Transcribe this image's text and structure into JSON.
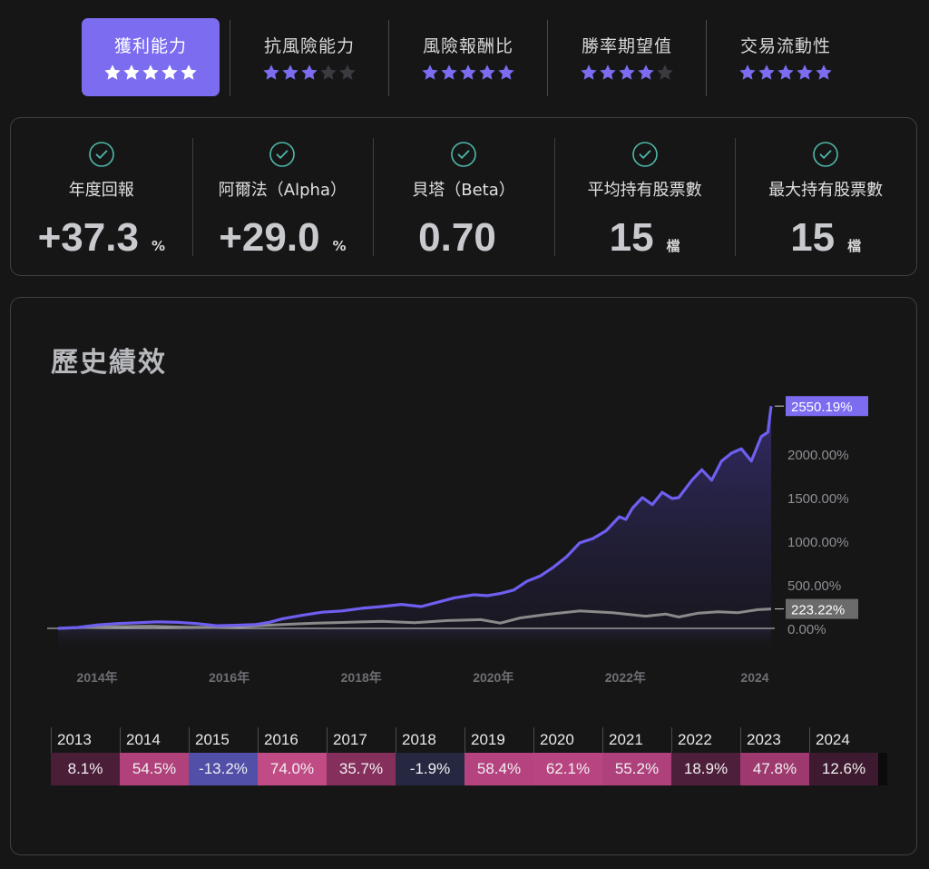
{
  "tabs": [
    {
      "label": "獲利能力",
      "stars": 5,
      "active": true
    },
    {
      "label": "抗風險能力",
      "stars": 3,
      "active": false
    },
    {
      "label": "風險報酬比",
      "stars": 5,
      "active": false
    },
    {
      "label": "勝率期望值",
      "stars": 4,
      "active": false
    },
    {
      "label": "交易流動性",
      "stars": 5,
      "active": false
    }
  ],
  "metrics": [
    {
      "label": "年度回報",
      "value": "+37.3",
      "unit": "%"
    },
    {
      "label": "阿爾法（Alpha）",
      "value": "+29.0",
      "unit": "%"
    },
    {
      "label": "貝塔（Beta）",
      "value": "0.70",
      "unit": ""
    },
    {
      "label": "平均持有股票數",
      "value": "15",
      "unit": "檔"
    },
    {
      "label": "最大持有股票數",
      "value": "15",
      "unit": "檔"
    }
  ],
  "performance": {
    "title": "歷史績效"
  },
  "colors": {
    "accent": "#7b6cf0",
    "star_on": "#7b6cf0",
    "star_off": "#3a3a3f",
    "check": "#4fb8a8",
    "strategy_line": "#6e5ff0",
    "benchmark_line": "#8a8a8a",
    "benchmark_badge": "#6b6b6b"
  },
  "chart_data": {
    "type": "line",
    "x_ticks": [
      "2014年",
      "2016年",
      "2018年",
      "2020年",
      "2022年",
      "2024"
    ],
    "y_ticks": [
      "2000.00%",
      "1500.00%",
      "1000.00%",
      "500.00%",
      "0.00%"
    ],
    "ylim": [
      0,
      2550
    ],
    "series": [
      {
        "end_label": "2550.19%",
        "points": [
          [
            2013.6,
            0
          ],
          [
            2013.9,
            10
          ],
          [
            2014.2,
            40
          ],
          [
            2014.5,
            55
          ],
          [
            2014.8,
            65
          ],
          [
            2015.1,
            75
          ],
          [
            2015.4,
            70
          ],
          [
            2015.7,
            55
          ],
          [
            2016.0,
            30
          ],
          [
            2016.3,
            35
          ],
          [
            2016.6,
            45
          ],
          [
            2016.8,
            70
          ],
          [
            2017.0,
            110
          ],
          [
            2017.3,
            150
          ],
          [
            2017.6,
            185
          ],
          [
            2017.9,
            200
          ],
          [
            2018.2,
            230
          ],
          [
            2018.5,
            250
          ],
          [
            2018.8,
            275
          ],
          [
            2019.1,
            250
          ],
          [
            2019.3,
            290
          ],
          [
            2019.6,
            350
          ],
          [
            2019.9,
            385
          ],
          [
            2020.1,
            375
          ],
          [
            2020.3,
            400
          ],
          [
            2020.5,
            440
          ],
          [
            2020.7,
            540
          ],
          [
            2020.9,
            600
          ],
          [
            2021.1,
            700
          ],
          [
            2021.3,
            820
          ],
          [
            2021.5,
            980
          ],
          [
            2021.7,
            1030
          ],
          [
            2021.9,
            1120
          ],
          [
            2022.1,
            1280
          ],
          [
            2022.2,
            1250
          ],
          [
            2022.3,
            1380
          ],
          [
            2022.45,
            1500
          ],
          [
            2022.6,
            1420
          ],
          [
            2022.75,
            1560
          ],
          [
            2022.9,
            1490
          ],
          [
            2023.0,
            1500
          ],
          [
            2023.2,
            1700
          ],
          [
            2023.35,
            1820
          ],
          [
            2023.5,
            1700
          ],
          [
            2023.65,
            1920
          ],
          [
            2023.8,
            2010
          ],
          [
            2023.95,
            2060
          ],
          [
            2024.1,
            1920
          ],
          [
            2024.25,
            2200
          ],
          [
            2024.35,
            2250
          ],
          [
            2024.4,
            2550
          ]
        ]
      },
      {
        "end_label": "223.22%",
        "points": [
          [
            2013.6,
            0
          ],
          [
            2014.0,
            10
          ],
          [
            2014.5,
            20
          ],
          [
            2015.0,
            25
          ],
          [
            2015.5,
            15
          ],
          [
            2016.0,
            10
          ],
          [
            2016.5,
            25
          ],
          [
            2017.0,
            45
          ],
          [
            2017.5,
            60
          ],
          [
            2018.0,
            70
          ],
          [
            2018.5,
            80
          ],
          [
            2019.0,
            65
          ],
          [
            2019.5,
            90
          ],
          [
            2020.0,
            100
          ],
          [
            2020.3,
            60
          ],
          [
            2020.6,
            120
          ],
          [
            2021.0,
            160
          ],
          [
            2021.5,
            200
          ],
          [
            2022.0,
            180
          ],
          [
            2022.5,
            140
          ],
          [
            2022.8,
            165
          ],
          [
            2023.0,
            130
          ],
          [
            2023.3,
            175
          ],
          [
            2023.6,
            190
          ],
          [
            2023.9,
            180
          ],
          [
            2024.2,
            215
          ],
          [
            2024.4,
            223
          ]
        ]
      }
    ]
  },
  "annual_returns": [
    {
      "year": "2013",
      "value": "8.1%",
      "color": "#4a1e36"
    },
    {
      "year": "2014",
      "value": "54.5%",
      "color": "#b0417a"
    },
    {
      "year": "2015",
      "value": "-13.2%",
      "color": "#514fa8"
    },
    {
      "year": "2016",
      "value": "74.0%",
      "color": "#c04b85"
    },
    {
      "year": "2017",
      "value": "35.7%",
      "color": "#85305c"
    },
    {
      "year": "2018",
      "value": "-1.9%",
      "color": "#262842"
    },
    {
      "year": "2019",
      "value": "58.4%",
      "color": "#b54380"
    },
    {
      "year": "2020",
      "value": "62.1%",
      "color": "#b84581"
    },
    {
      "year": "2021",
      "value": "55.2%",
      "color": "#ae417c"
    },
    {
      "year": "2022",
      "value": "18.9%",
      "color": "#4e1f3a"
    },
    {
      "year": "2023",
      "value": "47.8%",
      "color": "#9d396f"
    },
    {
      "year": "2024",
      "value": "12.6%",
      "color": "#3d1a2f"
    }
  ]
}
